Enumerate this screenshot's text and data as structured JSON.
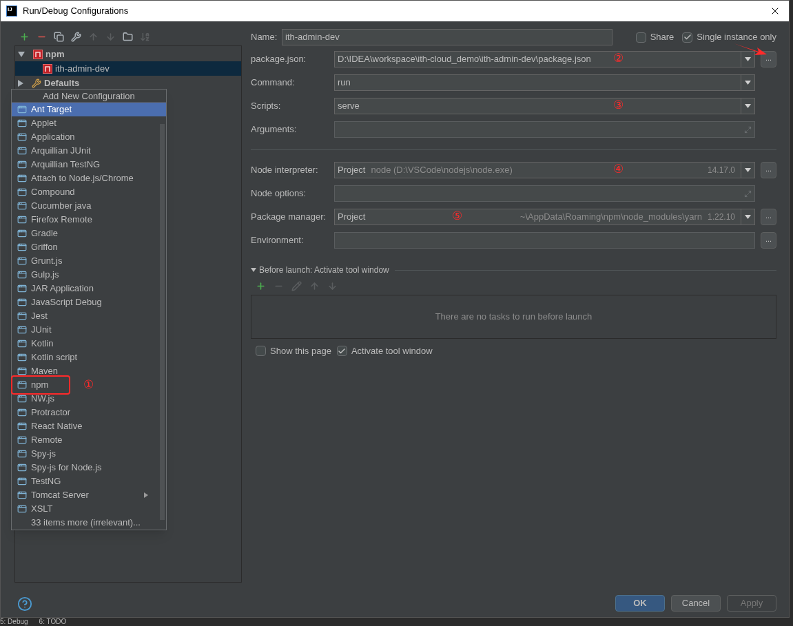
{
  "window": {
    "title": "Run/Debug Configurations",
    "logo": "IJ"
  },
  "toolbar": [
    {
      "kind": "add",
      "disabled": false
    },
    {
      "kind": "remove",
      "disabled": false
    },
    {
      "kind": "copy",
      "disabled": false
    },
    {
      "kind": "wrench",
      "disabled": false
    },
    {
      "kind": "up",
      "disabled": true
    },
    {
      "kind": "down",
      "disabled": true
    },
    {
      "kind": "folder",
      "disabled": false
    },
    {
      "kind": "sort",
      "disabled": true
    }
  ],
  "tree": [
    {
      "label": "npm",
      "expanded": true,
      "children": [
        {
          "label": "ith-admin-dev",
          "selected": true
        }
      ]
    },
    {
      "label": "Defaults",
      "expanded": false
    }
  ],
  "popup": {
    "title": "Add New Configuration",
    "items": [
      {
        "label": "Ant Target",
        "selected": true,
        "kind": "item",
        "annotated": false,
        "submenu": false
      },
      {
        "label": "Applet",
        "selected": false,
        "kind": "item",
        "annotated": false,
        "submenu": false
      },
      {
        "label": "Application",
        "selected": false,
        "kind": "item",
        "annotated": false,
        "submenu": false
      },
      {
        "label": "Arquillian JUnit",
        "selected": false,
        "kind": "item",
        "annotated": false,
        "submenu": false
      },
      {
        "label": "Arquillian TestNG",
        "selected": false,
        "kind": "item",
        "annotated": false,
        "submenu": false
      },
      {
        "label": "Attach to Node.js/Chrome",
        "selected": false,
        "kind": "item",
        "annotated": false,
        "submenu": false
      },
      {
        "label": "Compound",
        "selected": false,
        "kind": "item",
        "annotated": false,
        "submenu": false
      },
      {
        "label": "Cucumber java",
        "selected": false,
        "kind": "item",
        "annotated": false,
        "submenu": false
      },
      {
        "label": "Firefox Remote",
        "selected": false,
        "kind": "item",
        "annotated": false,
        "submenu": false
      },
      {
        "label": "Gradle",
        "selected": false,
        "kind": "item",
        "annotated": false,
        "submenu": false
      },
      {
        "label": "Griffon",
        "selected": false,
        "kind": "item",
        "annotated": false,
        "submenu": false
      },
      {
        "label": "Grunt.js",
        "selected": false,
        "kind": "item",
        "annotated": false,
        "submenu": false
      },
      {
        "label": "Gulp.js",
        "selected": false,
        "kind": "item",
        "annotated": false,
        "submenu": false
      },
      {
        "label": "JAR Application",
        "selected": false,
        "kind": "item",
        "annotated": false,
        "submenu": false
      },
      {
        "label": "JavaScript Debug",
        "selected": false,
        "kind": "item",
        "annotated": false,
        "submenu": false
      },
      {
        "label": "Jest",
        "selected": false,
        "kind": "item",
        "annotated": false,
        "submenu": false
      },
      {
        "label": "JUnit",
        "selected": false,
        "kind": "item",
        "annotated": false,
        "submenu": false
      },
      {
        "label": "Kotlin",
        "selected": false,
        "kind": "item",
        "annotated": false,
        "submenu": false
      },
      {
        "label": "Kotlin script",
        "selected": false,
        "kind": "item",
        "annotated": false,
        "submenu": false
      },
      {
        "label": "Maven",
        "selected": false,
        "kind": "item",
        "annotated": false,
        "submenu": false
      },
      {
        "label": "npm",
        "selected": false,
        "kind": "item",
        "annotated": true,
        "annotation": "①",
        "submenu": false
      },
      {
        "label": "NW.js",
        "selected": false,
        "kind": "item",
        "annotated": false,
        "submenu": false
      },
      {
        "label": "Protractor",
        "selected": false,
        "kind": "item",
        "annotated": false,
        "submenu": false
      },
      {
        "label": "React Native",
        "selected": false,
        "kind": "item",
        "annotated": false,
        "submenu": false
      },
      {
        "label": "Remote",
        "selected": false,
        "kind": "item",
        "annotated": false,
        "submenu": false
      },
      {
        "label": "Spy-js",
        "selected": false,
        "kind": "item",
        "annotated": false,
        "submenu": false
      },
      {
        "label": "Spy-js for Node.js",
        "selected": false,
        "kind": "item",
        "annotated": false,
        "submenu": false
      },
      {
        "label": "TestNG",
        "selected": false,
        "kind": "item",
        "annotated": false,
        "submenu": false
      },
      {
        "label": "Tomcat Server",
        "selected": false,
        "kind": "item",
        "annotated": false,
        "submenu": true
      },
      {
        "label": "XSLT",
        "selected": false,
        "kind": "item",
        "annotated": false,
        "submenu": false
      },
      {
        "label": "33 items more (irrelevant)...",
        "selected": false,
        "kind": "more",
        "annotated": false,
        "submenu": false
      }
    ]
  },
  "name_row": {
    "label": "Name:",
    "value": "ith-admin-dev",
    "share": {
      "label": "Share",
      "checked": false
    },
    "single_instance": {
      "label": "Single instance only",
      "checked": true
    }
  },
  "fields": [
    {
      "label": "package.json:",
      "kind": "combo",
      "value": "D:\\IDEA\\workspace\\ith-cloud_demo\\ith-admin-dev\\package.json",
      "annotation": "②",
      "browse": true,
      "arrow": true
    },
    {
      "label": "Command:",
      "kind": "combo",
      "value": "run"
    },
    {
      "label": "Scripts:",
      "kind": "combo",
      "value": "serve",
      "annotation": "③"
    },
    {
      "label": "Arguments:",
      "kind": "expand"
    },
    {
      "kind": "separator"
    },
    {
      "label": "Node interpreter:",
      "kind": "combo",
      "value": "Project",
      "detail": "node (D:\\VSCode\\nodejs\\node.exe)",
      "version": "14.17.0",
      "annotation": "④",
      "browse": true
    },
    {
      "label": "Node options:",
      "kind": "expand"
    },
    {
      "label": "Package manager:",
      "kind": "combo",
      "value": "Project",
      "path": "~\\AppData\\Roaming\\npm\\node_modules\\yarn",
      "version": "1.22.10",
      "annotation": "⑤",
      "browse": true
    },
    {
      "label": "Environment:",
      "kind": "text",
      "browse": true
    }
  ],
  "browse_label": "...",
  "before_launch": {
    "title": "Before launch: Activate tool window",
    "expanded": true,
    "tools": [
      {
        "kind": "add",
        "disabled": false
      },
      {
        "kind": "remove",
        "disabled": true
      },
      {
        "kind": "edit",
        "disabled": true
      },
      {
        "kind": "up",
        "disabled": true
      },
      {
        "kind": "down",
        "disabled": true
      }
    ],
    "empty_text": "There are no tasks to run before launch"
  },
  "options": [
    {
      "label": "Show this page",
      "checked": false
    },
    {
      "label": "Activate tool window",
      "checked": true
    }
  ],
  "buttons": [
    {
      "label": "OK",
      "kind": "primary",
      "disabled": false
    },
    {
      "label": "Cancel",
      "kind": "normal",
      "disabled": false
    },
    {
      "label": "Apply",
      "kind": "normal",
      "disabled": true
    }
  ],
  "status_tabs": [
    "5: Debug",
    "6: TODO"
  ]
}
